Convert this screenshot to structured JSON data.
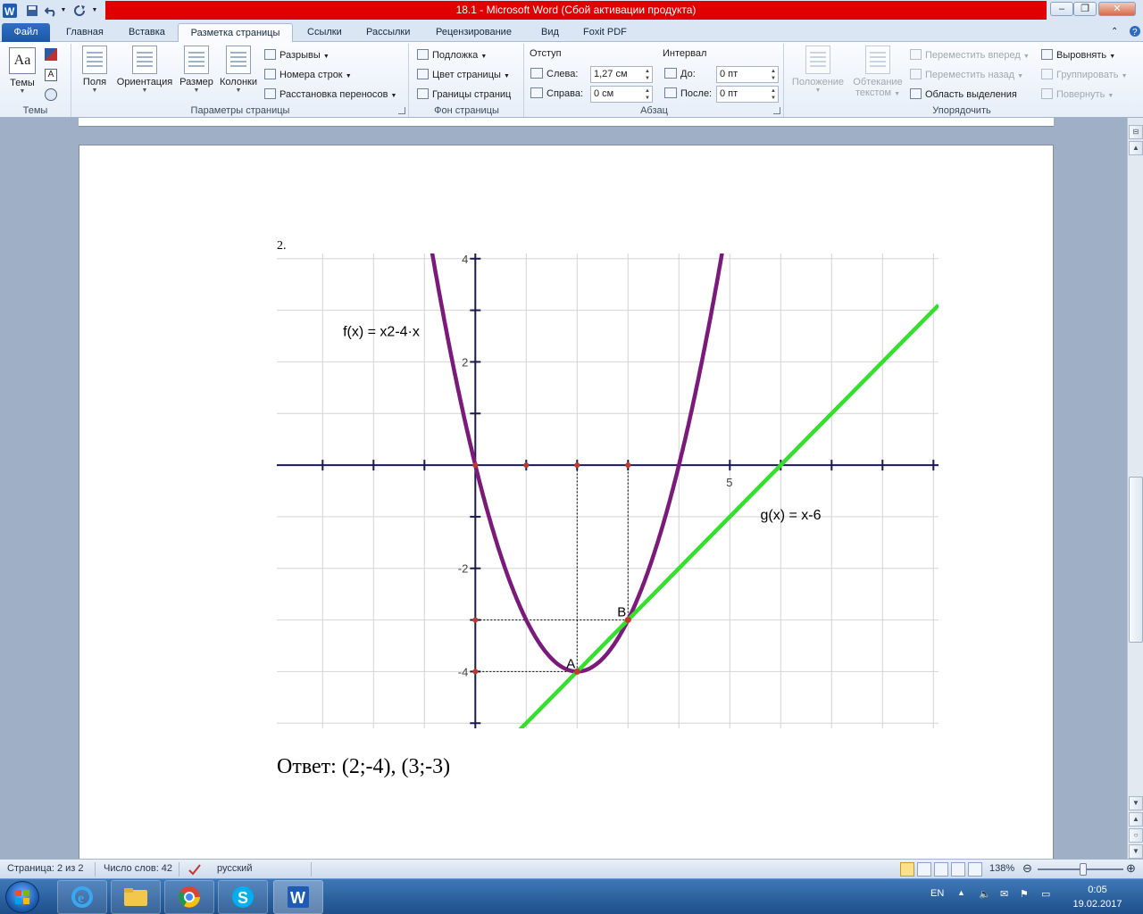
{
  "window": {
    "title": "18.1  -  Microsoft Word (Сбой активации продукта)"
  },
  "tabs": [
    {
      "label": "Файл"
    },
    {
      "label": "Главная"
    },
    {
      "label": "Вставка"
    },
    {
      "label": "Разметка страницы"
    },
    {
      "label": "Ссылки"
    },
    {
      "label": "Рассылки"
    },
    {
      "label": "Рецензирование"
    },
    {
      "label": "Вид"
    },
    {
      "label": "Foxit PDF"
    }
  ],
  "ribbon": {
    "themes": {
      "button": "Темы",
      "group": "Темы"
    },
    "page_setup": {
      "fields": "Поля",
      "orientation": "Ориентация",
      "size": "Размер",
      "columns": "Колонки",
      "breaks": "Разрывы",
      "line_numbers": "Номера строк",
      "hyphenation": "Расстановка переносов",
      "group": "Параметры страницы"
    },
    "page_background": {
      "watermark": "Подложка",
      "page_color": "Цвет страницы",
      "page_borders": "Границы страниц",
      "group": "Фон страницы"
    },
    "paragraph": {
      "indent_title": "Отступ",
      "indent_left_label": "Слева:",
      "indent_left_value": "1,27 см",
      "indent_right_label": "Справа:",
      "indent_right_value": "0 см",
      "spacing_title": "Интервал",
      "spacing_before_label": "До:",
      "spacing_before_value": "0 пт",
      "spacing_after_label": "После:",
      "spacing_after_value": "0 пт",
      "group": "Абзац"
    },
    "arrange": {
      "position": "Положение",
      "wrap_text_1": "Обтекание",
      "wrap_text_2": "текстом",
      "bring_forward": "Переместить вперед",
      "send_backward": "Переместить назад",
      "selection_pane": "Область выделения",
      "align": "Выровнять",
      "group_btn": "Группировать",
      "rotate": "Повернуть",
      "group": "Упорядочить"
    }
  },
  "document": {
    "paragraph_number": "2.",
    "answer": "Ответ: (2;-4), (3;-3)"
  },
  "chart_data": {
    "type": "line",
    "title": "",
    "xlabel": "",
    "ylabel": "",
    "xlim": [
      -3.9,
      9.1
    ],
    "ylim": [
      -5.1,
      4.1
    ],
    "grid": true,
    "x_ticks_labeled": [
      5
    ],
    "y_ticks_labeled": [
      4,
      2,
      -2,
      -4
    ],
    "x_tick_labels": [
      "5"
    ],
    "y_tick_labels": [
      "4",
      "2",
      "-2",
      "-4"
    ],
    "series": [
      {
        "name": "f(x) = x²-4·x",
        "expression": "x^2-4x",
        "color": "#7b1a7b"
      },
      {
        "name": "g(x) = x-6",
        "expression": "x-6",
        "color": "#33e02b"
      }
    ],
    "annotations": [
      {
        "text": "f(x) = x2-4·x",
        "at_x": -2.6,
        "at_y": 2.5
      },
      {
        "text": "g(x) = x-6",
        "at_x": 5.6,
        "at_y": -1.05
      }
    ],
    "points": [
      {
        "label": "A",
        "x": 2,
        "y": -4
      },
      {
        "label": "B",
        "x": 3,
        "y": -3
      }
    ],
    "marked_points": [
      {
        "x": 0,
        "y": 0
      },
      {
        "x": 1,
        "y": 0
      },
      {
        "x": 2,
        "y": 0
      },
      {
        "x": 3,
        "y": 0
      },
      {
        "x": 0,
        "y": -3
      },
      {
        "x": 0,
        "y": -4
      }
    ]
  },
  "statusbar": {
    "page": "Страница: 2 из 2",
    "words": "Число слов: 42",
    "language": "русский",
    "zoom": "138%"
  },
  "taskbar": {
    "language": "EN",
    "time": "0:05",
    "date": "19.02.2017"
  }
}
